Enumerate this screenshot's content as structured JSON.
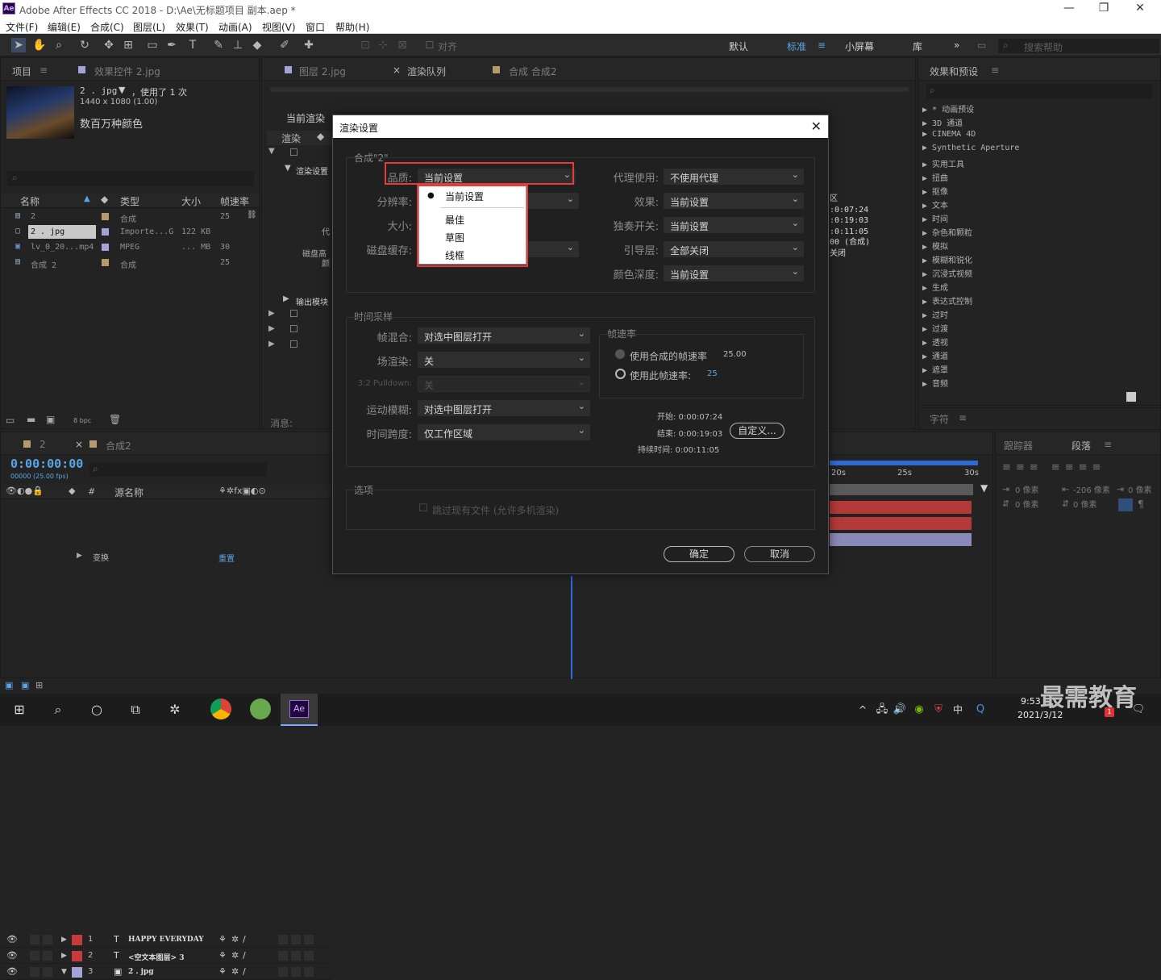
{
  "window": {
    "app_badge": "Ae",
    "title": "Adobe After Effects CC 2018 - D:\\Ae\\无标题项目 副本.aep *",
    "minimize": "—",
    "restore": "❐",
    "close": "✕"
  },
  "menu": [
    "文件(F)",
    "编辑(E)",
    "合成(C)",
    "图层(L)",
    "效果(T)",
    "动画(A)",
    "视图(V)",
    "窗口",
    "帮助(H)"
  ],
  "toolbar": {
    "align_label": "对齐",
    "workspaces": [
      "默认",
      "标准",
      "小屏幕",
      "库"
    ],
    "more": "»",
    "search_placeholder": "搜索帮助"
  },
  "project_panel": {
    "tabs": [
      "项目",
      "效果控件 2.jpg"
    ],
    "item_name": "2 . jpg",
    "item_usage": "，使用了 1 次",
    "item_dims": "1440 x 1080 (1.00)",
    "item_colors": "数百万种颜色",
    "columns": [
      "名称",
      "类型",
      "大小",
      "帧速率"
    ],
    "rows": [
      {
        "name": "2",
        "type": "合成",
        "size": "",
        "fps": "25"
      },
      {
        "name": "2 . jpg",
        "type": "Importe...G",
        "size": "122 KB",
        "fps": ""
      },
      {
        "name": "lv_0_20...mp4",
        "type": "MPEG",
        "size": "... MB",
        "fps": "30"
      },
      {
        "name": "合成 2",
        "type": "合成",
        "size": "",
        "fps": "25"
      }
    ],
    "bpc": "8 bpc"
  },
  "center_panel": {
    "tabs": [
      "图层 2.jpg",
      "渲染队列",
      "合成 合成2"
    ],
    "current_render": "当前渲染",
    "render_col": "渲染",
    "render_settings": "渲染设置",
    "proxy": "代",
    "disk_cache": "磁盘高",
    "color": "颜",
    "output_module": "输出模块",
    "messages": "消息:",
    "right_info": [
      "区",
      ":0:07:24",
      ":0:19:03",
      ":0:11:05",
      "00 (合成)",
      "关闭"
    ]
  },
  "effects_panel": {
    "title": "效果和预设",
    "items": [
      "* 动画预设",
      "3D 通道",
      "CINEMA 4D",
      "Synthetic Aperture",
      "实用工具",
      "扭曲",
      "抠像",
      "文本",
      "时间",
      "杂色和颗粒",
      "模拟",
      "模糊和锐化",
      "沉浸式视频",
      "生成",
      "表达式控制",
      "过时",
      "过渡",
      "透视",
      "通道",
      "遮罩",
      "音频"
    ],
    "character": "字符"
  },
  "timeline": {
    "tabs": [
      "2",
      "合成2"
    ],
    "timecode": "0:00:00:00",
    "frames": "00000 (25.00 fps)",
    "source_col": "源名称",
    "layers": [
      {
        "num": "1",
        "type": "T",
        "name": "HAPPY EVERYDAY",
        "color": "#c63a3a"
      },
      {
        "num": "2",
        "type": "T",
        "name": "<空文本图层> 3",
        "color": "#c63a3a"
      },
      {
        "num": "3",
        "type": "▣",
        "name": "2 . jpg",
        "color": "#a3a3d8"
      }
    ],
    "transform": "变换",
    "reset": "重置",
    "ruler": [
      "20s",
      "25s",
      "30s"
    ]
  },
  "tracker_panel": {
    "tabs": [
      "跟踪器",
      "段落"
    ],
    "px_labels": [
      "0 像素",
      "-206 像素",
      "0 像素",
      "0 像素",
      "0 像素"
    ]
  },
  "dialog": {
    "title": "渲染设置",
    "close": "✕",
    "comp_group": "合成\"2\"",
    "quality_label": "品质:",
    "quality_value": "当前设置",
    "resolution_label": "分辨率:",
    "size_label": "大小:",
    "disk_cache_label": "磁盘缓存:",
    "proxy_label": "代理使用:",
    "proxy_value": "不使用代理",
    "effects_label": "效果:",
    "effects_value": "当前设置",
    "solo_label": "独奏开关:",
    "solo_value": "当前设置",
    "guide_label": "引导层:",
    "guide_value": "全部关闭",
    "depth_label": "颜色深度:",
    "depth_value": "当前设置",
    "quality_options": [
      "当前设置",
      "最佳",
      "草图",
      "线框"
    ],
    "time_group": "时间采样",
    "frame_blend_label": "帧混合:",
    "frame_blend_value": "对选中图层打开",
    "field_label": "场渲染:",
    "field_value": "关",
    "pulldown_label": "3:2 Pulldown:",
    "pulldown_value": "关",
    "motion_blur_label": "运动模糊:",
    "motion_blur_value": "对选中图层打开",
    "time_span_label": "时间跨度:",
    "time_span_value": "仅工作区域",
    "fps_group": "帧速率",
    "use_comp_fps": "使用合成的帧速率",
    "comp_fps": "25.00",
    "use_this_fps": "使用此帧速率:",
    "this_fps": "25",
    "start": "开始: 0:00:07:24",
    "end": "结束: 0:00:19:03",
    "duration": "持续时间: 0:00:11:05",
    "custom_btn": "自定义...",
    "options_group": "选项",
    "skip_files": "跳过现有文件 (允许多机渲染)",
    "ok": "确定",
    "cancel": "取消"
  },
  "taskbar": {
    "time": "9:53",
    "date": "2021/3/12",
    "ime": "中",
    "watermark": "最需教育",
    "notify_count": "1"
  }
}
